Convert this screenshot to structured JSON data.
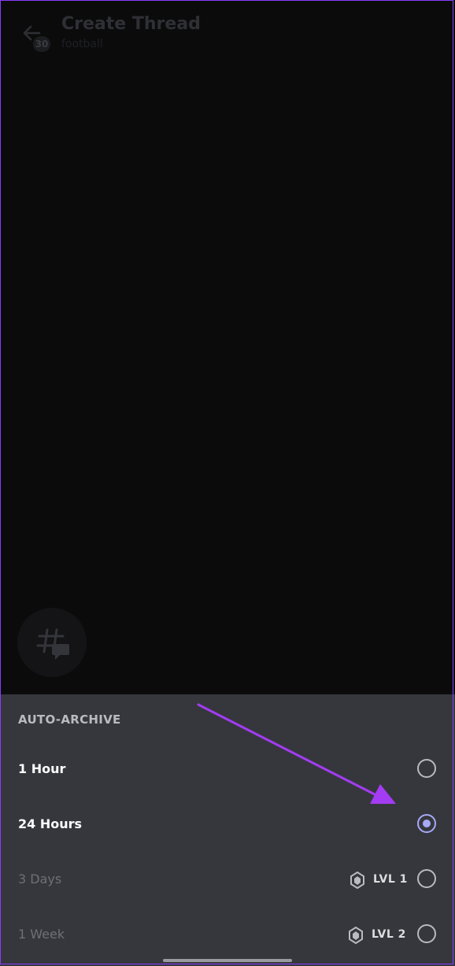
{
  "header": {
    "title": "Create Thread",
    "subtitle": "football",
    "badge": "30",
    "back_icon": "arrow-left-icon"
  },
  "fab": {
    "icon": "thread-icon"
  },
  "sheet": {
    "title": "AUTO-ARCHIVE",
    "options": [
      {
        "label": "1 Hour",
        "selected": false,
        "enabled": true
      },
      {
        "label": "24 Hours",
        "selected": true,
        "enabled": true
      },
      {
        "label": "3 Days",
        "selected": false,
        "enabled": false,
        "level": "LVL 1"
      },
      {
        "label": "1 Week",
        "selected": false,
        "enabled": false,
        "level": "LVL 2"
      }
    ]
  },
  "colors": {
    "accent": "#a7a9f7",
    "annotation_arrow": "#a33cf2",
    "sheet_bg": "#36373d"
  }
}
